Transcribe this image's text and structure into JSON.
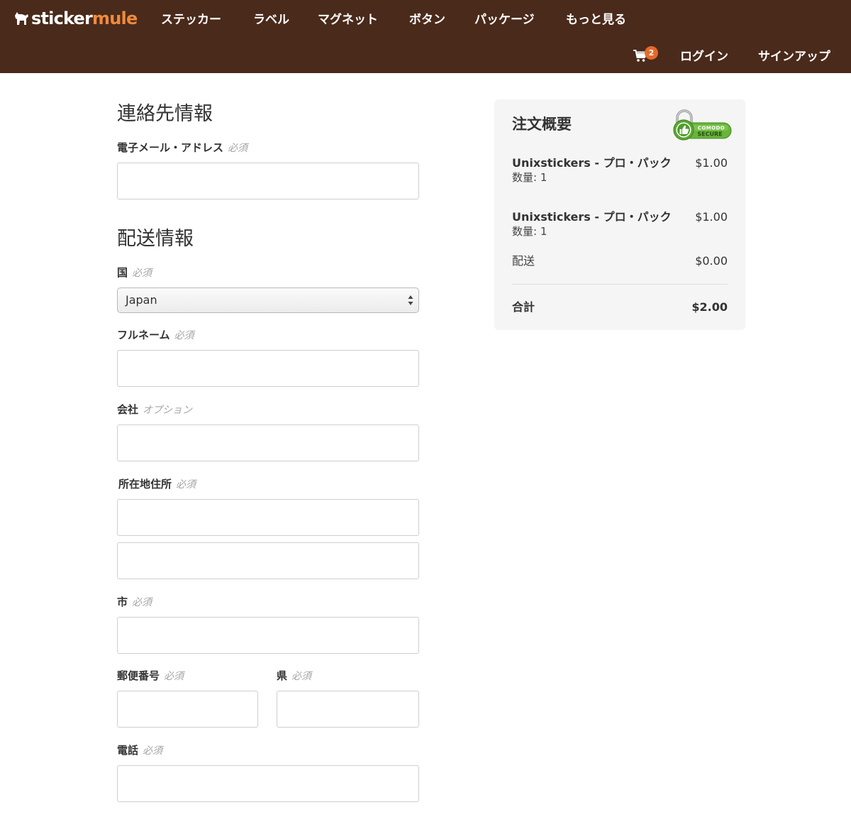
{
  "header": {
    "logo": {
      "part1": "sticker",
      "part2": "mule"
    },
    "nav": [
      {
        "label": "ステッカー"
      },
      {
        "label": "ラベル"
      },
      {
        "label": "マグネット"
      },
      {
        "label": "ボタン"
      },
      {
        "label": "パッケージ"
      },
      {
        "label": "もっと見る"
      }
    ],
    "cart_count": "2",
    "login": "ログイン",
    "signup": "サインアップ"
  },
  "form": {
    "contact_title": "連絡先情報",
    "email_label": "電子メール・アドレス",
    "shipping_title": "配送情報",
    "country_label": "国",
    "country_value": "Japan",
    "fullname_label": "フルネーム",
    "company_label": "会社",
    "address_label": "所在地住所",
    "city_label": "市",
    "postal_label": "郵便番号",
    "prefecture_label": "県",
    "phone_label": "電話",
    "required_text": "必須",
    "optional_text": "オプション"
  },
  "summary": {
    "title": "注文概要",
    "secure_badge": {
      "line1": "COMODO",
      "line2": "SECURE"
    },
    "items": [
      {
        "name": "Unixstickers - プロ・パック",
        "qty": "数量: 1",
        "price": "$1.00"
      },
      {
        "name": "Unixstickers - プロ・パック",
        "qty": "数量: 1",
        "price": "$1.00"
      }
    ],
    "shipping_label": "配送",
    "shipping_value": "$0.00",
    "total_label": "合計",
    "total_value": "$2.00"
  },
  "colors": {
    "header_bg": "#4a2a1b",
    "logo_accent": "#ef8a3c",
    "cart_badge": "#e56a2b",
    "summary_bg": "#f5f5f5"
  },
  "icons": [
    "mule-logo-icon",
    "cart-icon",
    "select-arrows-icon",
    "comodo-secure-badge-icon"
  ]
}
